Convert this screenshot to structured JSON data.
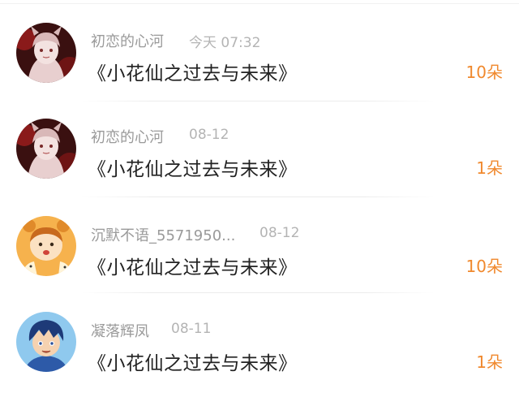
{
  "records": [
    {
      "user": "初恋的心河",
      "time": "今天 07:32",
      "book": "《小花仙之过去与未来》",
      "amount": "10朵",
      "avatar": "anime-girl-avatar"
    },
    {
      "user": "初恋的心河",
      "time": "08-12",
      "book": "《小花仙之过去与未来》",
      "amount": "1朵",
      "avatar": "anime-girl-avatar"
    },
    {
      "user": "沉默不语_5571950...",
      "time": "08-12",
      "book": "《小花仙之过去与未来》",
      "amount": "10朵",
      "avatar": "cartoon-kid-avatar"
    },
    {
      "user": "凝落辉凤",
      "time": "08-11",
      "book": "《小花仙之过去与未来》",
      "amount": "1朵",
      "avatar": "anime-boy-avatar"
    }
  ],
  "colors": {
    "amount": "#f0892e",
    "username": "#9a9a9a",
    "time": "#b4b4b4",
    "title": "#222222"
  }
}
